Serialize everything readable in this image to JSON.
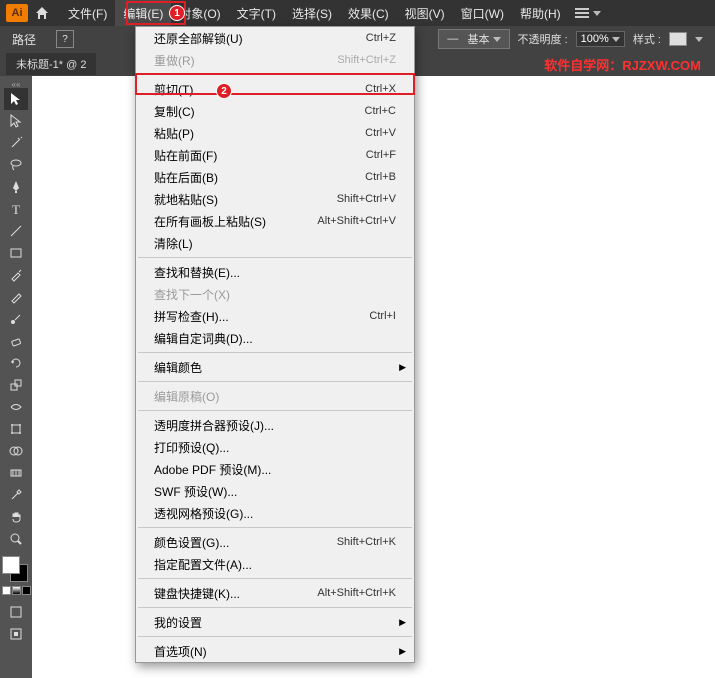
{
  "app": {
    "logo": "Ai"
  },
  "menubar": {
    "items": [
      "文件(F)",
      "编辑(E)",
      "对象(O)",
      "文字(T)",
      "选择(S)",
      "效果(C)",
      "视图(V)",
      "窗口(W)",
      "帮助(H)"
    ],
    "activeIndex": 1
  },
  "toolbar": {
    "label": "路径",
    "basic": "基本",
    "opacityLabel": "不透明度 :",
    "opacityValue": "100%",
    "styleLabel": "样式 :"
  },
  "tabbar": {
    "docTitle": "未标题-1* @ 2",
    "watermark": "软件自学网：RJZXW.COM"
  },
  "badges": {
    "b1": "1",
    "b2": "2"
  },
  "dropdown": {
    "groups": [
      [
        {
          "label": "还原全部解锁(U)",
          "shortcut": "Ctrl+Z",
          "disabled": false
        },
        {
          "label": "重做(R)",
          "shortcut": "Shift+Ctrl+Z",
          "disabled": true
        }
      ],
      [
        {
          "label": "剪切(T)",
          "shortcut": "Ctrl+X",
          "disabled": false,
          "highlighted": true
        },
        {
          "label": "复制(C)",
          "shortcut": "Ctrl+C",
          "disabled": false
        },
        {
          "label": "粘贴(P)",
          "shortcut": "Ctrl+V",
          "disabled": false
        },
        {
          "label": "贴在前面(F)",
          "shortcut": "Ctrl+F",
          "disabled": false
        },
        {
          "label": "贴在后面(B)",
          "shortcut": "Ctrl+B",
          "disabled": false
        },
        {
          "label": "就地粘贴(S)",
          "shortcut": "Shift+Ctrl+V",
          "disabled": false
        },
        {
          "label": "在所有画板上粘贴(S)",
          "shortcut": "Alt+Shift+Ctrl+V",
          "disabled": false
        },
        {
          "label": "清除(L)",
          "shortcut": "",
          "disabled": false
        }
      ],
      [
        {
          "label": "查找和替换(E)...",
          "shortcut": "",
          "disabled": false
        },
        {
          "label": "查找下一个(X)",
          "shortcut": "",
          "disabled": true
        },
        {
          "label": "拼写检查(H)...",
          "shortcut": "Ctrl+I",
          "disabled": false
        },
        {
          "label": "编辑自定词典(D)...",
          "shortcut": "",
          "disabled": false
        }
      ],
      [
        {
          "label": "编辑颜色",
          "shortcut": "",
          "disabled": false,
          "submenu": true
        }
      ],
      [
        {
          "label": "编辑原稿(O)",
          "shortcut": "",
          "disabled": true
        }
      ],
      [
        {
          "label": "透明度拼合器预设(J)...",
          "shortcut": "",
          "disabled": false
        },
        {
          "label": "打印预设(Q)...",
          "shortcut": "",
          "disabled": false
        },
        {
          "label": "Adobe PDF 预设(M)...",
          "shortcut": "",
          "disabled": false
        },
        {
          "label": "SWF 预设(W)...",
          "shortcut": "",
          "disabled": false
        },
        {
          "label": "透视网格预设(G)...",
          "shortcut": "",
          "disabled": false
        }
      ],
      [
        {
          "label": "颜色设置(G)...",
          "shortcut": "Shift+Ctrl+K",
          "disabled": false
        },
        {
          "label": "指定配置文件(A)...",
          "shortcut": "",
          "disabled": false
        }
      ],
      [
        {
          "label": "键盘快捷键(K)...",
          "shortcut": "Alt+Shift+Ctrl+K",
          "disabled": false
        }
      ],
      [
        {
          "label": "我的设置",
          "shortcut": "",
          "disabled": false,
          "submenu": true
        }
      ],
      [
        {
          "label": "首选项(N)",
          "shortcut": "",
          "disabled": false,
          "submenu": true
        }
      ]
    ]
  },
  "tools": [
    "selection",
    "direct-selection",
    "magic-wand",
    "lasso",
    "pen",
    "type",
    "line",
    "rectangle",
    "paintbrush",
    "pencil",
    "blob",
    "eraser",
    "rotate",
    "scale",
    "width",
    "free-transform",
    "shape-builder",
    "perspective",
    "mesh",
    "gradient",
    "eyedropper",
    "blend",
    "symbol",
    "column-graph",
    "artboard",
    "slice",
    "hand",
    "zoom"
  ]
}
